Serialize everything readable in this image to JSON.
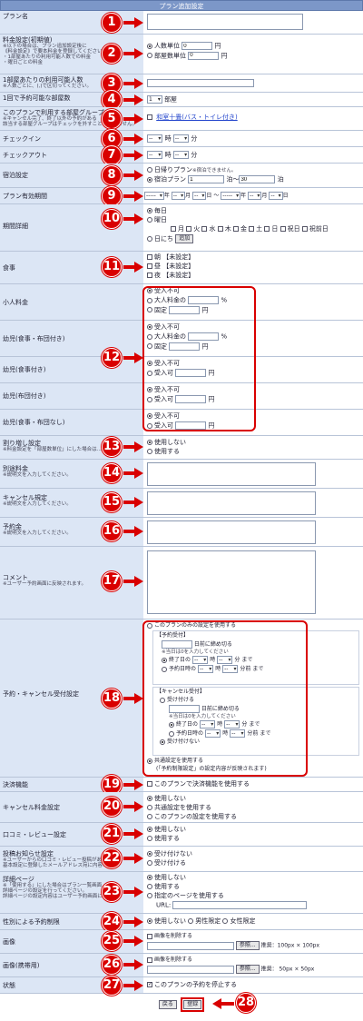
{
  "header": {
    "title": "プラン追加設定"
  },
  "rows": {
    "plan_name": {
      "label": "プラン名",
      "num": "1"
    },
    "fee_setting": {
      "label": "料金設定(初期値)",
      "notes": [
        "※以下の場合は、プラン追加設定後に",
        "《料金設定》で要本料金を登録してください。",
        "・1部屋あたりの利用可能人数での料金",
        "・曜日ごとの料金"
      ],
      "num": "2",
      "opt1": "人数単位",
      "opt2": "部屋数単位",
      "unit": "円",
      "value1": "0",
      "value2": "0"
    },
    "capacity": {
      "label": "1部屋あたりの利用可能人数",
      "note": "※人数ごとに、(,)で区切ってください。",
      "num": "3"
    },
    "rooms": {
      "label": "1回で予約可能な部屋数",
      "num": "4",
      "value": "1",
      "unit": "部屋"
    },
    "room_group": {
      "label": "このプランで利用する部屋グループ",
      "notes": [
        "※キャンセル完了、終了以外の予約がある",
        "該当する部屋グループはチェックを外すことはできません。"
      ],
      "num": "5",
      "link": "和室十畳(バス・トイレ付き)"
    },
    "checkin": {
      "label": "チェックイン",
      "num": "6",
      "hour": "時",
      "minute": "分",
      "ph": "--"
    },
    "checkout": {
      "label": "チェックアウト",
      "num": "7",
      "hour": "時",
      "minute": "分",
      "ph": "--"
    },
    "stay": {
      "label": "宿泊設定",
      "num": "8",
      "opt1": "日帰りプラン",
      "opt1_note": "※宿泊できません。",
      "opt2": "宿泊プラン",
      "from": "1",
      "to": "30",
      "unit1": "泊～",
      "unit2": "泊"
    },
    "period": {
      "label": "プラン有効期間",
      "num": "9",
      "year_ph": "-----",
      "mon_ph": "--",
      "day_ph": "--",
      "y": "年",
      "m": "月",
      "d": "日",
      "tilde": "～"
    },
    "schedule": {
      "label": "期間詳細",
      "num": "10",
      "opt1": "毎日",
      "opt2": "曜日",
      "days": [
        "月",
        "火",
        "水",
        "木",
        "金",
        "土",
        "日",
        "祝日",
        "祝前日"
      ],
      "opt3": "日にち",
      "add": "追加"
    },
    "meals": {
      "label": "食事",
      "num": "11",
      "items": [
        "朝 【未設定】",
        "昼 【未設定】",
        "夜 【未設定】"
      ]
    },
    "child": {
      "num": "12",
      "rows": [
        {
          "label": "小人料金",
          "opts": [
            "受入不可",
            "大人料金の",
            "固定"
          ],
          "pct": "%",
          "yen": "円"
        },
        {
          "label": "幼児(食事・布団付き)",
          "opts": [
            "受入不可",
            "大人料金の",
            "固定"
          ],
          "pct": "%",
          "yen": "円"
        },
        {
          "label": "幼児(食事付き)",
          "opts": [
            "受入不可",
            "受入可"
          ],
          "yen": "円"
        },
        {
          "label": "幼児(布団付き)",
          "opts": [
            "受入不可",
            "受入可"
          ],
          "yen": "円"
        },
        {
          "label": "幼児(食事・布団なし)",
          "opts": [
            "受入不可",
            "受入可"
          ],
          "yen": "円"
        }
      ]
    },
    "discount": {
      "label": "割り増し設定",
      "note": "※料金設定を「部屋数単位」にした場合は...",
      "num": "13",
      "opts": [
        "使用しない",
        "使用する"
      ]
    },
    "separate_fee": {
      "label": "別途料金",
      "note": "※説明文を入力してください。",
      "num": "14"
    },
    "cancel_policy": {
      "label": "キャンセル規定",
      "note": "※説明文を入力してください。",
      "num": "15"
    },
    "deposit": {
      "label": "予約金",
      "note": "※説明文を入力してください。",
      "num": "16"
    },
    "comment": {
      "label": "コメント",
      "note": "※ユーザー予約画面に反映されます。",
      "num": "17"
    },
    "reservation": {
      "label": "予約・キャンセル受付設定",
      "num": "18",
      "opt_plan": "このプランのみの設定を使用する",
      "res_head": "【予約受付】",
      "res_days": "日前に締め切る",
      "res_note": "※当日は0を入力してください",
      "res_end": "終了日の",
      "res_time": "予約日時の",
      "hour": "時",
      "minute": "分",
      "made": "まで",
      "before_made": "分前 まで",
      "can_head": "【キャンセル受付】",
      "can_accept": "受け付ける",
      "can_days": "日前に締め切る",
      "can_note": "※当日は0を入力してください",
      "can_end": "終了日の",
      "can_time": "予約日時の",
      "can_reject": "受け付けない",
      "opt_common": "共通設定を使用する",
      "opt_common_note": "(「予約制限設定」の設定内容が反映されます)"
    },
    "payment": {
      "label": "決済機能",
      "num": "19",
      "text": "このプランで決済機能を使用する"
    },
    "cancel_fee": {
      "label": "キャンセル料金設定",
      "num": "20",
      "opts": [
        "使用しない",
        "共通設定を使用する",
        "このプランの設定を使用する"
      ]
    },
    "review": {
      "label": "口コミ・レビュー設定",
      "num": "21",
      "opts": [
        "使用しない",
        "使用する"
      ]
    },
    "notice": {
      "label": "投稿お知らせ設定",
      "notes": [
        "※ユーザーからの口コミ・レビュー投稿があ...",
        "基本設定に登録したメールアドレス宛に内容..."
      ],
      "num": "22",
      "opts": [
        "受け付けない",
        "受け付ける"
      ]
    },
    "detail_page": {
      "label": "詳細ページ",
      "notes": [
        "※「使用する」にした場合はプラン一覧画面...",
        "詳細ページの設定を行ってください。",
        "詳細ページの設定内容はユーザー予約画面に反映..."
      ],
      "num": "23",
      "opts": [
        "使用しない",
        "使用する",
        "指定のページを使用する"
      ],
      "url": "URL:"
    },
    "gender": {
      "label": "性別による予約制限",
      "num": "24",
      "opts": [
        "使用しない",
        "男性限定",
        "女性限定"
      ]
    },
    "image": {
      "label": "画像",
      "num": "25",
      "del": "画像を削除する",
      "browse": "参照...",
      "rec": "推奨：100px × 100px"
    },
    "image_mobile": {
      "label": "画像(携帯用)",
      "num": "26",
      "del": "画像を削除する",
      "browse": "参照...",
      "rec": "推奨： 50px × 50px"
    },
    "status": {
      "label": "状態",
      "num": "27",
      "text": "このプランの予約を停止する"
    }
  },
  "footer": {
    "back": "戻る",
    "register": "登録",
    "num": "28"
  }
}
